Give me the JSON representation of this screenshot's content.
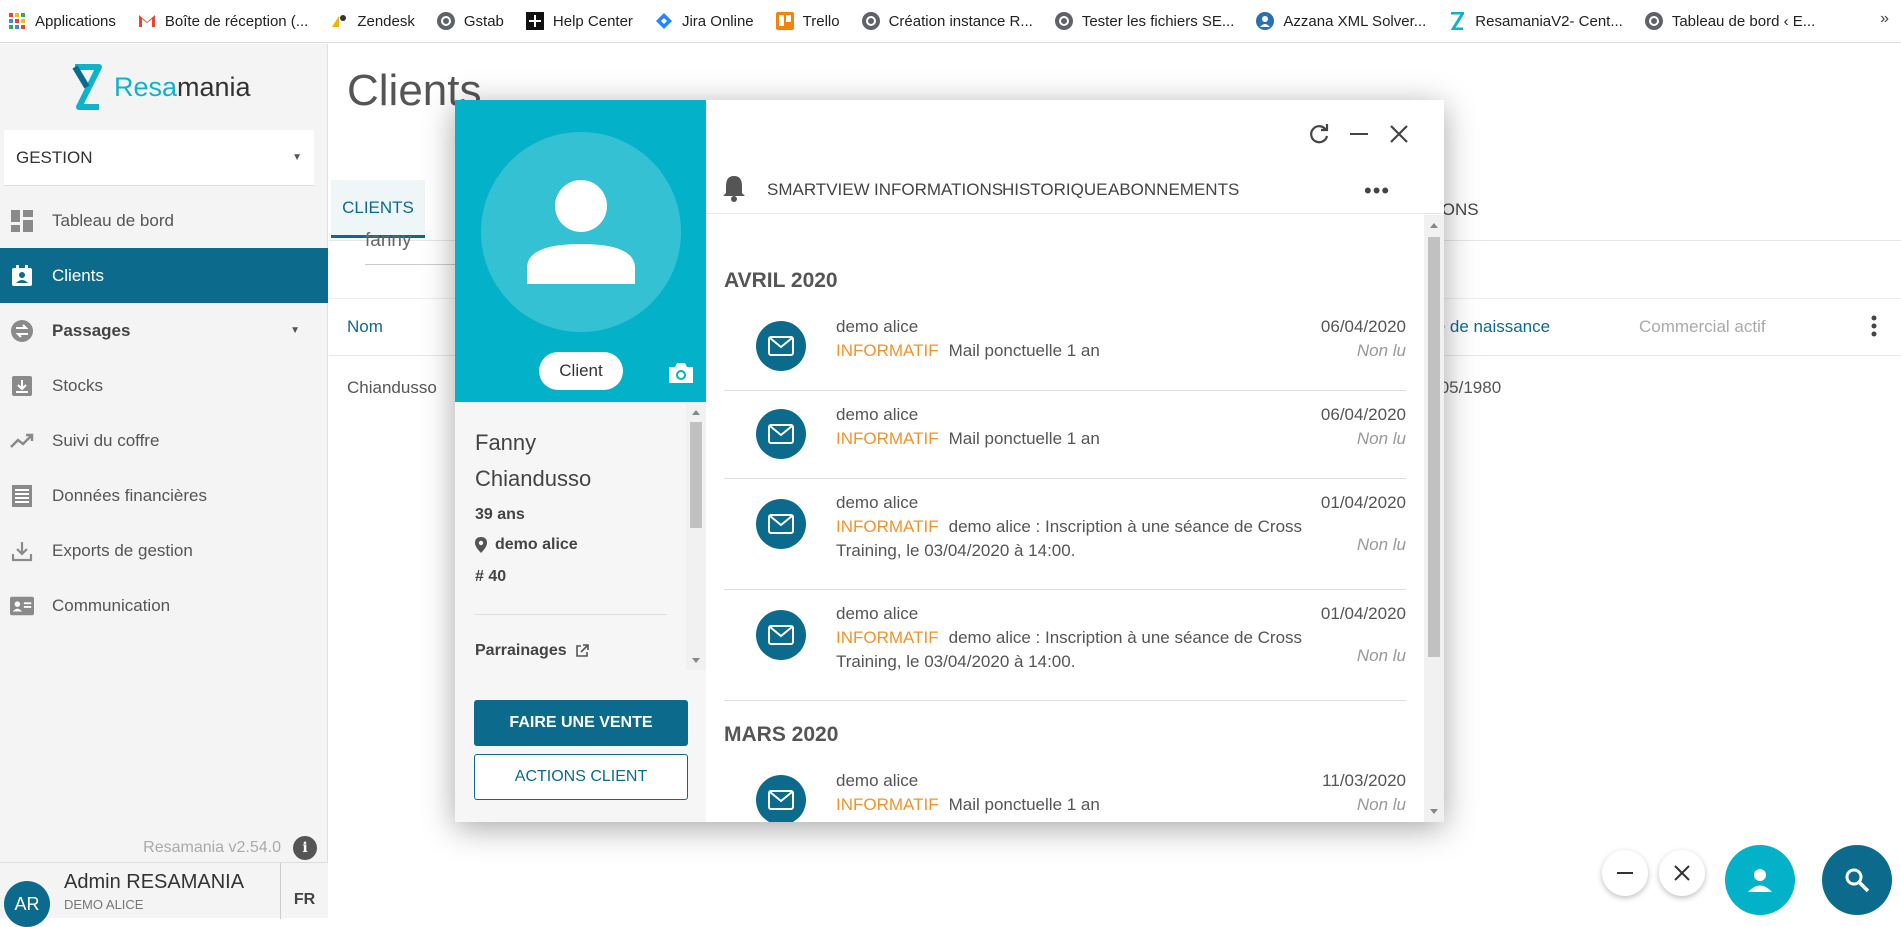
{
  "bookmarks": [
    {
      "label": "Applications",
      "icon": "apps-grid-icon",
      "color": "#ea4335"
    },
    {
      "label": "Boîte de réception (...",
      "icon": "gmail-icon",
      "color": "#ea4335"
    },
    {
      "label": "Zendesk",
      "icon": "zendesk-icon",
      "color": "#f0b400"
    },
    {
      "label": "Gstab",
      "icon": "globe-icon",
      "color": "#5f6368"
    },
    {
      "label": "Help Center",
      "icon": "plus-square-icon",
      "color": "#111111"
    },
    {
      "label": "Jira Online",
      "icon": "jira-icon",
      "color": "#2684ff"
    },
    {
      "label": "Trello",
      "icon": "trello-icon",
      "color": "#f5820b"
    },
    {
      "label": "Création instance R...",
      "icon": "globe-icon",
      "color": "#5f6368"
    },
    {
      "label": "Tester les fichiers SE...",
      "icon": "globe-icon",
      "color": "#5f6368"
    },
    {
      "label": "Azzana XML Solver...",
      "icon": "azzana-icon",
      "color": "#2a6fb5"
    },
    {
      "label": "ResamaniaV2- Cent...",
      "icon": "resamania-icon",
      "color": "#0fb3c9"
    },
    {
      "label": "Tableau de bord ‹ E...",
      "icon": "globe-icon",
      "color": "#5f6368"
    }
  ],
  "bookmarks_more": "»",
  "sidebar": {
    "logo_part1": "Resa",
    "logo_part2": "mania",
    "section": "GESTION",
    "items": [
      {
        "label": "Tableau de bord",
        "icon": "dashboard-icon"
      },
      {
        "label": "Clients",
        "icon": "contact-card-icon"
      },
      {
        "label": "Passages",
        "icon": "swap-icon"
      },
      {
        "label": "Stocks",
        "icon": "stock-box-icon"
      },
      {
        "label": "Suivi du coffre",
        "icon": "trending-up-icon"
      },
      {
        "label": "Données financières",
        "icon": "list-doc-icon"
      },
      {
        "label": "Exports de gestion",
        "icon": "download-icon"
      },
      {
        "label": "Communication",
        "icon": "id-card-icon"
      }
    ],
    "version": "Resamania v2.54.0",
    "user_initials": "AR",
    "user_name": "Admin RESAMANIA",
    "user_sub": "DEMO ALICE",
    "lang": "FR"
  },
  "main": {
    "title": "Clients",
    "tab_clients": "CLIENTS",
    "tab_right": "IONS",
    "search_value": "fanny",
    "col_nom": "Nom",
    "col_naissance": "te de naissance",
    "col_commercial": "Commercial actif",
    "row_name": "Chiandusso",
    "row_date": "/05/1980"
  },
  "profile": {
    "badge": "Client",
    "first_name": "Fanny",
    "last_name": "Chiandusso",
    "age": "39 ans",
    "location": "demo alice",
    "id": "# 40",
    "parrainages": "Parrainages",
    "btn_vente": "FAIRE UNE VENTE",
    "btn_actions": "ACTIONS CLIENT"
  },
  "modal_tabs": [
    "SMARTVIEW",
    "INFORMATIONS",
    "HISTORIQUE",
    "ABONNEMENTS"
  ],
  "modal_more": "•••",
  "feed": {
    "month1": "AVRIL 2020",
    "month2": "MARS 2020",
    "tag": "INFORMATIF",
    "messages": [
      {
        "sender": "demo alice",
        "text": "Mail ponctuelle 1 an",
        "date": "06/04/2020",
        "status": "Non lu"
      },
      {
        "sender": "demo alice",
        "text": "Mail ponctuelle 1 an",
        "date": "06/04/2020",
        "status": "Non lu"
      },
      {
        "sender": "demo alice",
        "text": "demo alice : Inscription à une séance de Cross Training, le 03/04/2020 à 14:00.",
        "date": "01/04/2020",
        "status": "Non lu"
      },
      {
        "sender": "demo alice",
        "text": "demo alice : Inscription à une séance de Cross Training, le 03/04/2020 à 14:00.",
        "date": "01/04/2020",
        "status": "Non lu"
      },
      {
        "sender": "demo alice",
        "text": "Mail ponctuelle 1 an",
        "date": "11/03/2020",
        "status": "Non lu"
      }
    ]
  },
  "colors": {
    "primary": "#0c6b8c",
    "accent": "#03b1c9",
    "tag": "#f0932b"
  }
}
